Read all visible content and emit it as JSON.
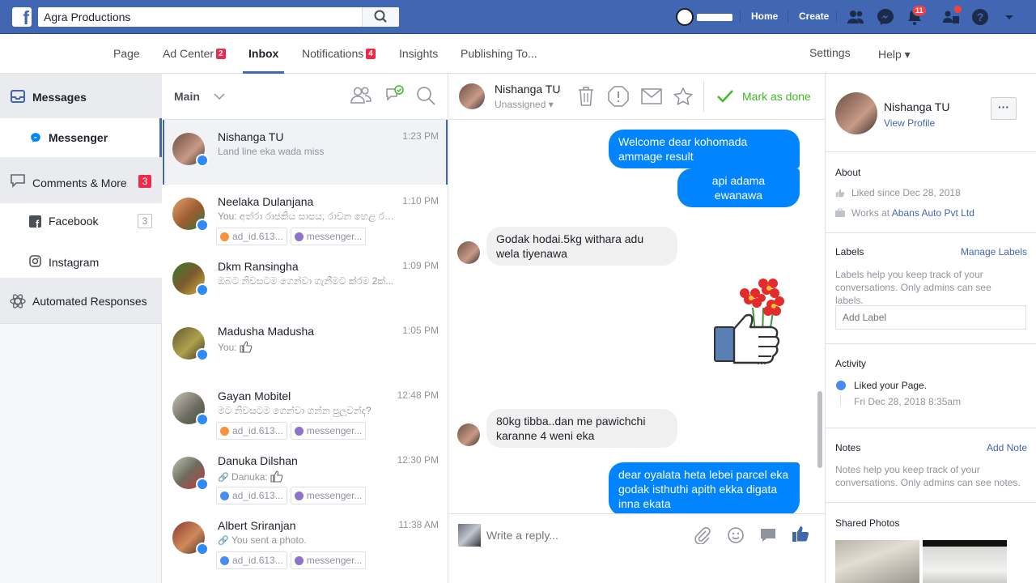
{
  "search": {
    "value": "Agra Productions"
  },
  "topnav": {
    "home": "Home",
    "create": "Create",
    "notif_count": "11"
  },
  "page_tabs": [
    {
      "label": "Page"
    },
    {
      "label": "Ad Center",
      "count": "2"
    },
    {
      "label": "Inbox"
    },
    {
      "label": "Notifications",
      "count": "4"
    },
    {
      "label": "Insights"
    },
    {
      "label": "Publishing To..."
    },
    {
      "label": "Settings"
    },
    {
      "label": "Help ▾"
    }
  ],
  "sidebar": {
    "messages": "Messages",
    "messenger": "Messenger",
    "comments": "Comments & More",
    "comments_count": "3",
    "facebook": "Facebook",
    "facebook_count": "3",
    "instagram": "Instagram",
    "automated": "Automated Responses"
  },
  "list_header": {
    "filter": "Main"
  },
  "conversations": [
    {
      "name": "Nishanga TU",
      "time": "1:23 PM",
      "snippet": "Land line eka wada miss",
      "tags": []
    },
    {
      "name": "Neelaka Dulanjana",
      "time": "1:10 PM",
      "snippet": "You: අත්රා රාජකිය සාපය, රාවන හෙළ රනස්...",
      "tags": [
        "ad_id.613...",
        "messenger..."
      ]
    },
    {
      "name": "Dkm Ransingha",
      "time": "1:09 PM",
      "snippet": "ඔබට නිවසටම ගෙන්වා ගැනීමට ක්රම 2ක්...",
      "tags": []
    },
    {
      "name": "Madusha Madusha",
      "time": "1:05 PM",
      "snippet": "You:",
      "tags": []
    },
    {
      "name": "Gayan Mobitel",
      "time": "12:48 PM",
      "snippet": "මට නිවසටම ගෙන්වා ගන්න පුලුවන්ද?",
      "tags": [
        "ad_id.613...",
        "messenger..."
      ]
    },
    {
      "name": "Danuka Dilshan",
      "time": "12:30 PM",
      "snippet": "Danuka:",
      "tags": [
        "ad_id.613...",
        "messenger..."
      ]
    },
    {
      "name": "Albert Sriranjan",
      "time": "11:38 AM",
      "snippet": "You sent a photo.",
      "tags": [
        "ad_id.613...",
        "messenger..."
      ]
    }
  ],
  "chat": {
    "name": "Nishanga TU",
    "assignee": "Unassigned",
    "mark_done": "Mark as done",
    "messages": [
      {
        "dir": "out",
        "text": "Welcome dear kohomada ammage result"
      },
      {
        "dir": "out",
        "text": "api adama ewanawa"
      },
      {
        "dir": "in",
        "text": "Godak hodai.5kg withara adu wela tiyenawa"
      },
      {
        "dir": "in",
        "text": "80kg tibba..dan me pawichchi karanne 4 weni eka"
      },
      {
        "dir": "out",
        "text": "dear oyalata heta lebei parcel eka godak isthuthi apith ekka digata inna ekata"
      }
    ],
    "reply_placeholder": "Write a reply..."
  },
  "profile": {
    "name": "Nishanga TU",
    "view_profile": "View Profile",
    "about_title": "About",
    "liked_since": "Liked since Dec 28, 2018",
    "works_prefix": "Works at ",
    "works_at": "Abans Auto Pvt Ltd",
    "labels_title": "Labels",
    "manage_labels": "Manage Labels",
    "labels_help": "Labels help you keep track of your conversations. Only admins can see labels.",
    "add_label_placeholder": "Add Label",
    "activity_title": "Activity",
    "activity_item": "Liked your Page.",
    "activity_date": "Fri Dec 28, 2018 8:35am",
    "notes_title": "Notes",
    "add_note": "Add Note",
    "notes_help": "Notes help you keep track of your conversations. Only admins can see notes.",
    "shared_photos": "Shared Photos"
  },
  "colors": {
    "brand": "#4267b2",
    "outgoing": "#0084ff",
    "done_green": "#42b72a",
    "badge_red": "#fa3e3e"
  }
}
